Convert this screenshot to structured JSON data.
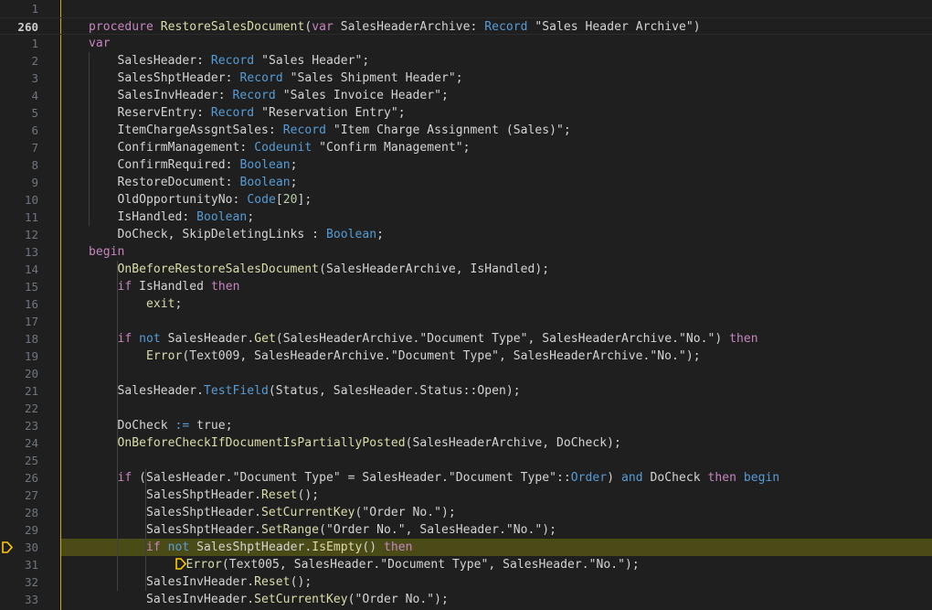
{
  "editor": {
    "colors": {
      "background": "#1f1f1f",
      "line_number": "#6e7681",
      "keyword": "#c586c0",
      "keyword_blue": "#569cd6",
      "string": "#ce9178",
      "function": "#dcdcaa",
      "paused_line_highlight": "#4b4b18",
      "breakpoint_marker": "#ffcc00"
    },
    "current_line_number": "260",
    "paused_line_number": "31",
    "lines": [
      {
        "n": "1",
        "tokens": []
      },
      {
        "n": "260",
        "tokens": [
          [
            "procedure ",
            "kw"
          ],
          [
            "RestoreSalesDocument",
            "fn"
          ],
          [
            "(",
            "pl"
          ],
          [
            "var ",
            "kw"
          ],
          [
            "SalesHeaderArchive",
            "pl"
          ],
          [
            ": ",
            "pl"
          ],
          [
            "Record ",
            "kb"
          ],
          [
            "\"Sales Header Archive\"",
            "pl"
          ],
          [
            ")",
            "pl"
          ]
        ]
      },
      {
        "n": "1",
        "tokens": [
          [
            "var",
            "kw"
          ]
        ]
      },
      {
        "n": "2",
        "tokens": [
          [
            "    SalesHeader",
            "pl"
          ],
          [
            ": ",
            "pl"
          ],
          [
            "Record ",
            "kb"
          ],
          [
            "\"Sales Header\";",
            "pl"
          ]
        ]
      },
      {
        "n": "3",
        "tokens": [
          [
            "    SalesShptHeader",
            "pl"
          ],
          [
            ": ",
            "pl"
          ],
          [
            "Record ",
            "kb"
          ],
          [
            "\"Sales Shipment Header\";",
            "pl"
          ]
        ]
      },
      {
        "n": "4",
        "tokens": [
          [
            "    SalesInvHeader",
            "pl"
          ],
          [
            ": ",
            "pl"
          ],
          [
            "Record ",
            "kb"
          ],
          [
            "\"Sales Invoice Header\";",
            "pl"
          ]
        ]
      },
      {
        "n": "5",
        "tokens": [
          [
            "    ReservEntry",
            "pl"
          ],
          [
            ": ",
            "pl"
          ],
          [
            "Record ",
            "kb"
          ],
          [
            "\"Reservation Entry\";",
            "pl"
          ]
        ]
      },
      {
        "n": "6",
        "tokens": [
          [
            "    ItemChargeAssgntSales",
            "pl"
          ],
          [
            ": ",
            "pl"
          ],
          [
            "Record ",
            "kb"
          ],
          [
            "\"Item Charge Assignment (Sales)\";",
            "pl"
          ]
        ]
      },
      {
        "n": "7",
        "tokens": [
          [
            "    ConfirmManagement",
            "pl"
          ],
          [
            ": ",
            "pl"
          ],
          [
            "Codeunit ",
            "kb"
          ],
          [
            "\"Confirm Management\";",
            "pl"
          ]
        ]
      },
      {
        "n": "8",
        "tokens": [
          [
            "    ConfirmRequired",
            "pl"
          ],
          [
            ": ",
            "pl"
          ],
          [
            "Boolean",
            "kb"
          ],
          [
            ";",
            "pl"
          ]
        ]
      },
      {
        "n": "9",
        "tokens": [
          [
            "    RestoreDocument",
            "pl"
          ],
          [
            ": ",
            "pl"
          ],
          [
            "Boolean",
            "kb"
          ],
          [
            ";",
            "pl"
          ]
        ]
      },
      {
        "n": "10",
        "tokens": [
          [
            "    OldOpportunityNo",
            "pl"
          ],
          [
            ": ",
            "pl"
          ],
          [
            "Code",
            "kb"
          ],
          [
            "[",
            "pl"
          ],
          [
            "20",
            "nm"
          ],
          [
            "];",
            "pl"
          ]
        ]
      },
      {
        "n": "11",
        "tokens": [
          [
            "    IsHandled",
            "pl"
          ],
          [
            ": ",
            "pl"
          ],
          [
            "Boolean",
            "kb"
          ],
          [
            ";",
            "pl"
          ]
        ]
      },
      {
        "n": "12",
        "tokens": [
          [
            "    DoCheck, SkipDeletingLinks : ",
            "pl"
          ],
          [
            "Boolean",
            "kb"
          ],
          [
            ";",
            "pl"
          ]
        ]
      },
      {
        "n": "13",
        "tokens": [
          [
            "begin",
            "kw"
          ]
        ]
      },
      {
        "n": "14",
        "tokens": [
          [
            "    ",
            "pl"
          ],
          [
            "OnBeforeRestoreSalesDocument",
            "fn"
          ],
          [
            "(SalesHeaderArchive, IsHandled);",
            "pl"
          ]
        ]
      },
      {
        "n": "15",
        "tokens": [
          [
            "    ",
            "pl"
          ],
          [
            "if ",
            "kw"
          ],
          [
            "IsHandled ",
            "pl"
          ],
          [
            "then",
            "kw"
          ]
        ]
      },
      {
        "n": "16",
        "tokens": [
          [
            "        ",
            "pl"
          ],
          [
            "exit",
            "fn"
          ],
          [
            ";",
            "pl"
          ]
        ]
      },
      {
        "n": "17",
        "tokens": []
      },
      {
        "n": "18",
        "tokens": [
          [
            "    ",
            "pl"
          ],
          [
            "if ",
            "kw"
          ],
          [
            "not ",
            "kb"
          ],
          [
            "SalesHeader.",
            "pl"
          ],
          [
            "Get",
            "fn"
          ],
          [
            "(SalesHeaderArchive.",
            "pl"
          ],
          [
            "\"Document Type\"",
            "pl"
          ],
          [
            ", SalesHeaderArchive.",
            "pl"
          ],
          [
            "\"No.\"",
            "pl"
          ],
          [
            ") ",
            "pl"
          ],
          [
            "then",
            "kw"
          ]
        ]
      },
      {
        "n": "19",
        "tokens": [
          [
            "        ",
            "pl"
          ],
          [
            "Error",
            "fn"
          ],
          [
            "(Text009, SalesHeaderArchive.",
            "pl"
          ],
          [
            "\"Document Type\"",
            "pl"
          ],
          [
            ", SalesHeaderArchive.",
            "pl"
          ],
          [
            "\"No.\"",
            "pl"
          ],
          [
            ");",
            "pl"
          ]
        ]
      },
      {
        "n": "20",
        "tokens": []
      },
      {
        "n": "21",
        "tokens": [
          [
            "    SalesHeader.",
            "pl"
          ],
          [
            "TestField",
            "kb"
          ],
          [
            "(Status, SalesHeader.Status::Open);",
            "pl"
          ]
        ]
      },
      {
        "n": "22",
        "tokens": []
      },
      {
        "n": "23",
        "tokens": [
          [
            "    DoCheck ",
            "pl"
          ],
          [
            ":= ",
            "kb"
          ],
          [
            "true",
            "pl"
          ],
          [
            ";",
            "pl"
          ]
        ]
      },
      {
        "n": "24",
        "tokens": [
          [
            "    ",
            "pl"
          ],
          [
            "OnBeforeCheckIfDocumentIsPartiallyPosted",
            "fn"
          ],
          [
            "(SalesHeaderArchive, DoCheck);",
            "pl"
          ]
        ]
      },
      {
        "n": "25",
        "tokens": []
      },
      {
        "n": "26",
        "tokens": [
          [
            "    ",
            "pl"
          ],
          [
            "if ",
            "kw"
          ],
          [
            "(SalesHeader.",
            "pl"
          ],
          [
            "\"Document Type\"",
            "pl"
          ],
          [
            " = SalesHeader.",
            "pl"
          ],
          [
            "\"Document Type\"",
            "pl"
          ],
          [
            "::",
            "pl"
          ],
          [
            "Order",
            "kb"
          ],
          [
            ") ",
            "pl"
          ],
          [
            "and ",
            "kb"
          ],
          [
            "DoCheck ",
            "pl"
          ],
          [
            "then ",
            "kw"
          ],
          [
            "begin",
            "kb"
          ]
        ]
      },
      {
        "n": "27",
        "tokens": [
          [
            "        SalesShptHeader.",
            "pl"
          ],
          [
            "Reset",
            "fn"
          ],
          [
            "();",
            "pl"
          ]
        ]
      },
      {
        "n": "28",
        "tokens": [
          [
            "        SalesShptHeader.",
            "pl"
          ],
          [
            "SetCurrentKey",
            "fn"
          ],
          [
            "(",
            "pl"
          ],
          [
            "\"Order No.\"",
            "pl"
          ],
          [
            ");",
            "pl"
          ]
        ]
      },
      {
        "n": "29",
        "tokens": [
          [
            "        SalesShptHeader.",
            "pl"
          ],
          [
            "SetRange",
            "fn"
          ],
          [
            "(",
            "pl"
          ],
          [
            "\"Order No.\"",
            "pl"
          ],
          [
            ", SalesHeader.",
            "pl"
          ],
          [
            "\"No.\"",
            "pl"
          ],
          [
            ");",
            "pl"
          ]
        ]
      },
      {
        "n": "30",
        "tokens": [
          [
            "        ",
            "pl"
          ],
          [
            "if ",
            "kw"
          ],
          [
            "not ",
            "kb"
          ],
          [
            "SalesShptHeader.",
            "pl"
          ],
          [
            "IsEmpty",
            "fn"
          ],
          [
            "() ",
            "pl"
          ],
          [
            "then",
            "kw"
          ]
        ]
      },
      {
        "n": "31",
        "tokens": [
          [
            "            ",
            "pl"
          ],
          [
            "@marker",
            "marker"
          ],
          [
            "Error",
            "fn"
          ],
          [
            "(Text005, SalesHeader.",
            "pl"
          ],
          [
            "\"Document Type\"",
            "pl"
          ],
          [
            ", SalesHeader.",
            "pl"
          ],
          [
            "\"No.\"",
            "pl"
          ],
          [
            ");",
            "pl"
          ]
        ]
      },
      {
        "n": "32",
        "tokens": [
          [
            "        SalesInvHeader.",
            "pl"
          ],
          [
            "Reset",
            "fn"
          ],
          [
            "();",
            "pl"
          ]
        ]
      },
      {
        "n": "33",
        "tokens": [
          [
            "        SalesInvHeader.",
            "pl"
          ],
          [
            "SetCurrentKey",
            "fn"
          ],
          [
            "(",
            "pl"
          ],
          [
            "\"Order No.\"",
            "pl"
          ],
          [
            ");",
            "pl"
          ]
        ]
      }
    ]
  }
}
